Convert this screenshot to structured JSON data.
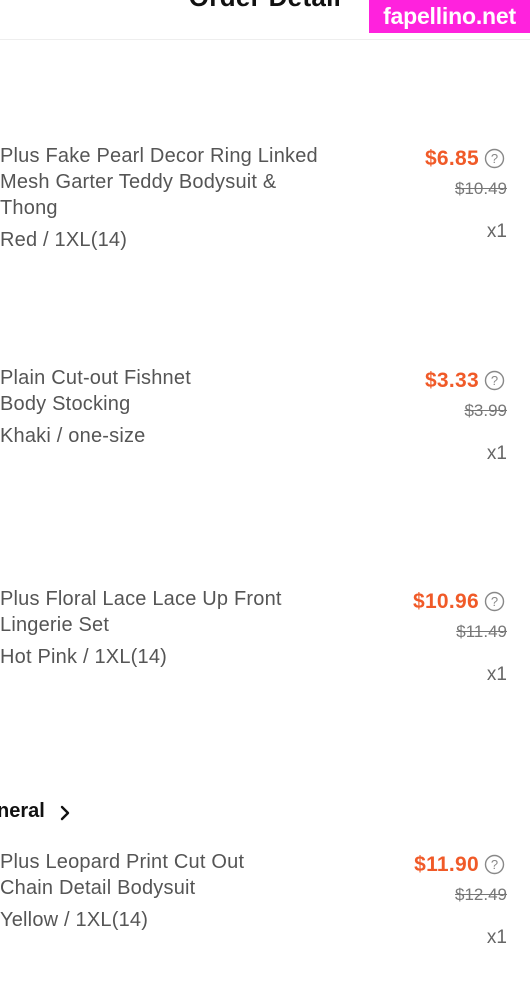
{
  "header": {
    "title": "Order Detail"
  },
  "watermark": "fapellino.net",
  "store": {
    "label": "neral"
  },
  "items": [
    {
      "name": "Plus Fake Pearl Decor Ring Linked Mesh Garter Teddy Bodysuit & Thong",
      "variant": "Red / 1XL(14)",
      "price": "$6.85",
      "original_price": "$10.49",
      "quantity": "x1"
    },
    {
      "name": "Plain Cut-out Fishnet Body Stocking",
      "variant": "Khaki / one-size",
      "price": "$3.33",
      "original_price": "$3.99",
      "quantity": "x1"
    },
    {
      "name": "Plus Floral Lace Lace Up Front Lingerie Set",
      "variant": "Hot Pink / 1XL(14)",
      "price": "$10.96",
      "original_price": "$11.49",
      "quantity": "x1"
    },
    {
      "name": "Plus Leopard Print Cut Out Chain Detail Bodysuit",
      "variant": "Yellow / 1XL(14)",
      "price": "$11.90",
      "original_price": "$12.49",
      "quantity": "x1"
    }
  ],
  "colors": {
    "price": "#f05a28",
    "watermark_bg": "#ff22dd"
  },
  "icons": {
    "price_help": "question-circle-icon",
    "store_link": "chevron-right-icon"
  }
}
